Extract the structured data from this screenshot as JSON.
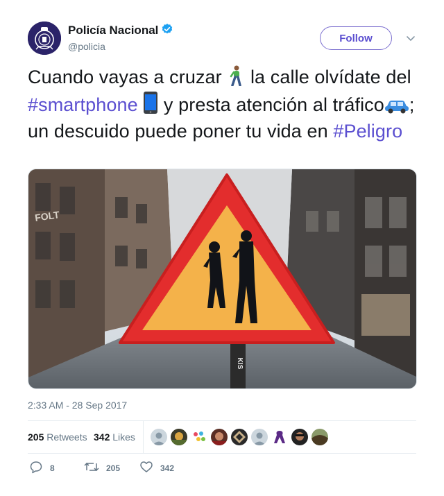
{
  "account": {
    "name": "Policía Nacional",
    "handle": "@policia",
    "follow_label": "Follow"
  },
  "tweet": {
    "text_1": "Cuando vayas a cruzar ",
    "text_2": " la calle olvídate del ",
    "hashtag_1": "#smartphone",
    "text_3": " y presta atención al tráfico",
    "text_4": "; un descuido puede poner tu vida en ",
    "hashtag_2": "#Peligro",
    "emojis": [
      "person-walking-emoji",
      "mobile-phone-emoji",
      "car-emoji"
    ]
  },
  "media": {
    "sign_sticker_text": "KIS"
  },
  "timestamp": "2:33 AM - 28 Sep 2017",
  "stats": {
    "retweets_count": "205",
    "retweets_label": "Retweets",
    "likes_count": "342",
    "likes_label": "Likes"
  },
  "actions": {
    "reply_count": "8",
    "retweet_count": "205",
    "like_count": "342"
  },
  "colors": {
    "accent": "#5b4fd0",
    "verified": "#1da1f2",
    "muted": "#657786"
  }
}
